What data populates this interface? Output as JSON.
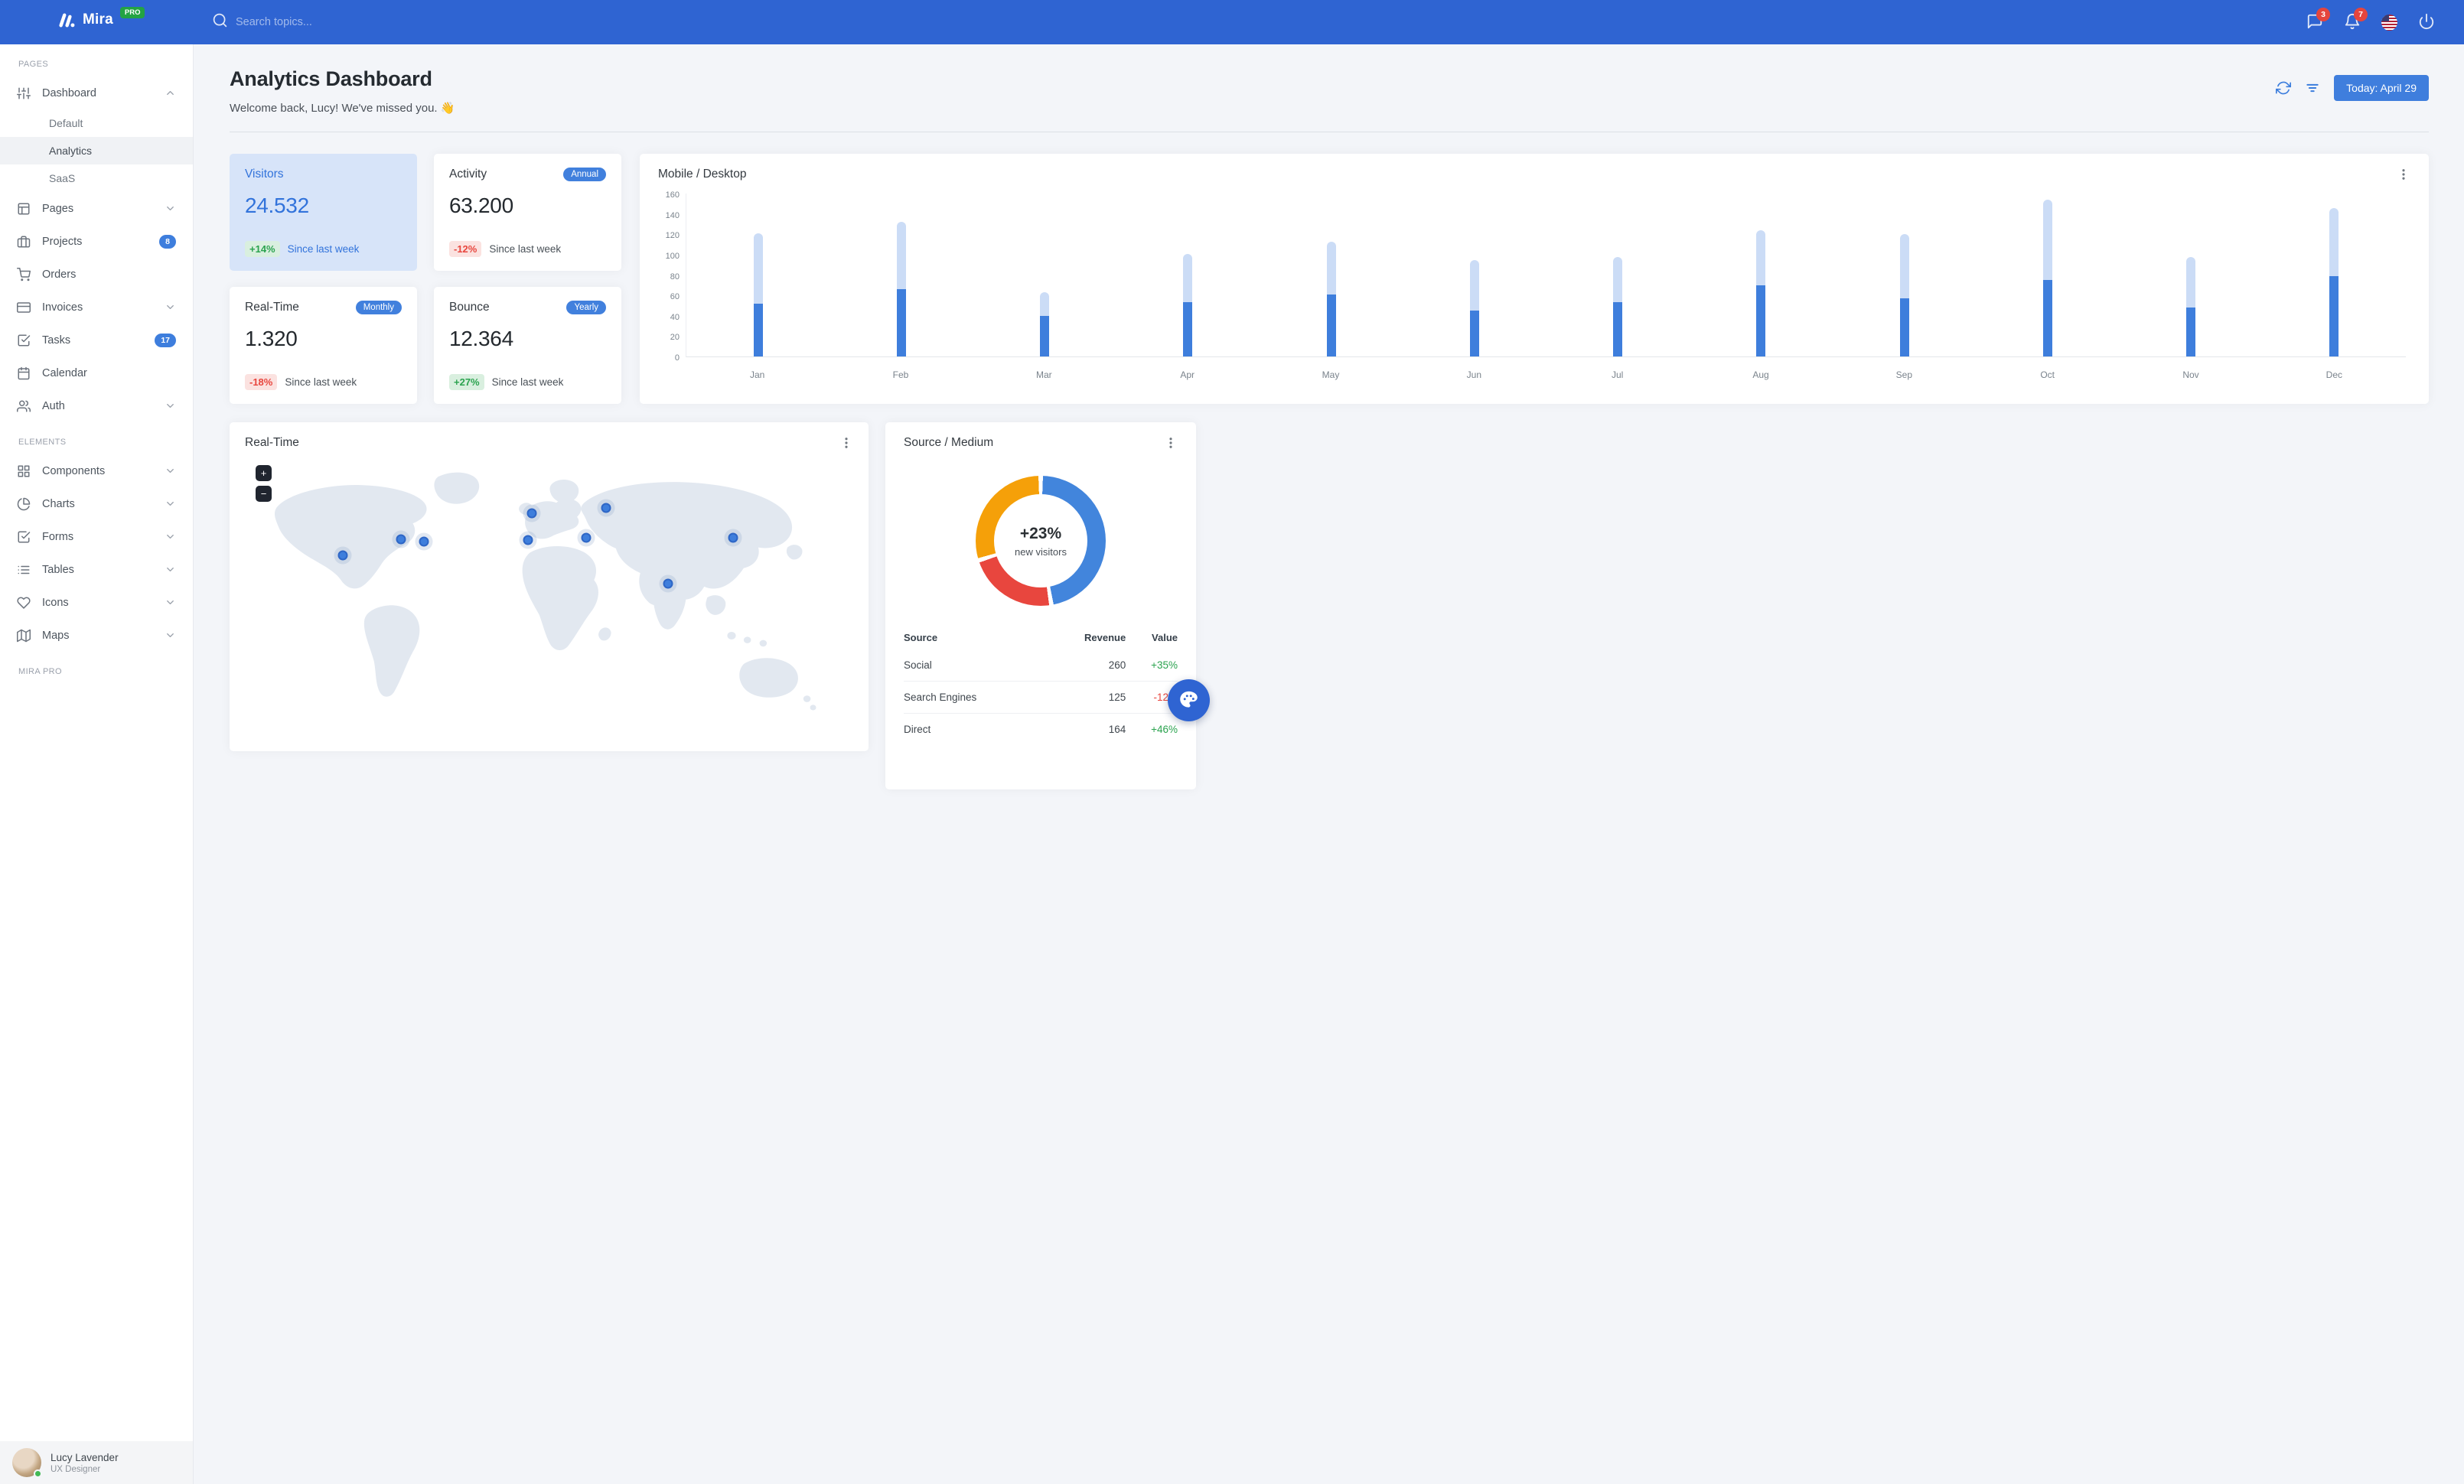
{
  "navbar": {
    "brand": "Mira",
    "brand_badge": "PRO",
    "search_placeholder": "Search topics...",
    "messages_count": "3",
    "notifications_count": "7"
  },
  "sidebar": {
    "sections": [
      {
        "label": "PAGES",
        "items": [
          {
            "label": "Dashboard",
            "icon": "sliders",
            "expanded": true,
            "children": [
              {
                "label": "Default"
              },
              {
                "label": "Analytics",
                "active": true
              },
              {
                "label": "SaaS"
              }
            ]
          },
          {
            "label": "Pages",
            "icon": "layout",
            "chevron": "down"
          },
          {
            "label": "Projects",
            "icon": "briefcase",
            "badge": "8"
          },
          {
            "label": "Orders",
            "icon": "shopping-cart"
          },
          {
            "label": "Invoices",
            "icon": "credit-card",
            "chevron": "down"
          },
          {
            "label": "Tasks",
            "icon": "check-square",
            "badge": "17"
          },
          {
            "label": "Calendar",
            "icon": "calendar"
          },
          {
            "label": "Auth",
            "icon": "users",
            "chevron": "down"
          }
        ]
      },
      {
        "label": "ELEMENTS",
        "items": [
          {
            "label": "Components",
            "icon": "grid",
            "chevron": "down"
          },
          {
            "label": "Charts",
            "icon": "pie-chart",
            "chevron": "down"
          },
          {
            "label": "Forms",
            "icon": "check-square",
            "chevron": "down"
          },
          {
            "label": "Tables",
            "icon": "list",
            "chevron": "down"
          },
          {
            "label": "Icons",
            "icon": "heart",
            "chevron": "down"
          },
          {
            "label": "Maps",
            "icon": "map",
            "chevron": "down"
          }
        ]
      },
      {
        "label": "MIRA PRO",
        "items": []
      }
    ],
    "user": {
      "name": "Lucy Lavender",
      "role": "UX Designer",
      "status": "online"
    }
  },
  "header": {
    "title": "Analytics Dashboard",
    "subtitle": "Welcome back, Lucy! We've missed you. 👋",
    "date_button": "Today: April 29"
  },
  "stat_cards": [
    {
      "title": "Visitors",
      "value": "24.532",
      "delta": "+14%",
      "delta_type": "positive",
      "note": "Since last week",
      "variant": "primary"
    },
    {
      "title": "Activity",
      "value": "63.200",
      "tag": "Annual",
      "delta": "-12%",
      "delta_type": "negative",
      "note": "Since last week"
    },
    {
      "title": "Real-Time",
      "value": "1.320",
      "tag": "Monthly",
      "delta": "-18%",
      "delta_type": "negative",
      "note": "Since last week"
    },
    {
      "title": "Bounce",
      "value": "12.364",
      "tag": "Yearly",
      "delta": "+27%",
      "delta_type": "positive",
      "note": "Since last week"
    }
  ],
  "chart_data": [
    {
      "id": "mobile_desktop",
      "type": "bar",
      "stacked": true,
      "title": "Mobile / Desktop",
      "categories": [
        "Jan",
        "Feb",
        "Mar",
        "Apr",
        "May",
        "Jun",
        "Jul",
        "Aug",
        "Sep",
        "Oct",
        "Nov",
        "Dec"
      ],
      "series": [
        {
          "name": "Mobile",
          "color": "#3e7edc",
          "values": [
            52,
            66,
            40,
            53,
            61,
            45,
            53,
            70,
            57,
            75,
            48,
            79
          ]
        },
        {
          "name": "Desktop",
          "color": "#cbdcf6",
          "values": [
            69,
            66,
            23,
            48,
            52,
            50,
            45,
            54,
            63,
            79,
            50,
            67
          ]
        }
      ],
      "xlabel": "",
      "ylabel": "",
      "ylim": [
        0,
        160
      ],
      "yticks": [
        0,
        20,
        40,
        60,
        80,
        100,
        120,
        140,
        160
      ],
      "grid": false,
      "legend": "none"
    },
    {
      "id": "source_medium",
      "type": "donut",
      "title": "Source / Medium",
      "center_value": "+23%",
      "center_label": "new visitors",
      "segments": [
        {
          "label": "Social",
          "value": 260,
          "color": "#4285dc"
        },
        {
          "label": "Search Engines",
          "value": 125,
          "color": "#e8463e"
        },
        {
          "label": "Direct",
          "value": 164,
          "color": "#f5a009"
        }
      ]
    }
  ],
  "map_card": {
    "title": "Real-Time",
    "zoom_in": "+",
    "zoom_out": "−",
    "markers": [
      {
        "name": "marker-san-francisco",
        "x": 16.1,
        "y": 36.6
      },
      {
        "name": "marker-chicago",
        "x": 25.7,
        "y": 30.7
      },
      {
        "name": "marker-new-york",
        "x": 29.4,
        "y": 31.6
      },
      {
        "name": "marker-london",
        "x": 47.2,
        "y": 21.1
      },
      {
        "name": "marker-madrid",
        "x": 46.6,
        "y": 30.8
      },
      {
        "name": "marker-moscow",
        "x": 59.4,
        "y": 19.1
      },
      {
        "name": "marker-ankara",
        "x": 56.1,
        "y": 30.1
      },
      {
        "name": "marker-delhi",
        "x": 69.5,
        "y": 47.0
      },
      {
        "name": "marker-beijing",
        "x": 80.3,
        "y": 30.1
      }
    ]
  },
  "source_table": {
    "columns": [
      "Source",
      "Revenue",
      "Value"
    ],
    "rows": [
      {
        "source": "Social",
        "revenue": "260",
        "value": "+35%",
        "trend": "positive"
      },
      {
        "source": "Search Engines",
        "revenue": "125",
        "value": "-12%",
        "trend": "negative"
      },
      {
        "source": "Direct",
        "revenue": "164",
        "value": "+46%",
        "trend": "positive"
      }
    ]
  },
  "colors": {
    "primary": "#3b7ddd",
    "navbar": "#2f64d2",
    "success": "#2ba34f",
    "danger": "#e8463e",
    "warning": "#f5a009"
  }
}
